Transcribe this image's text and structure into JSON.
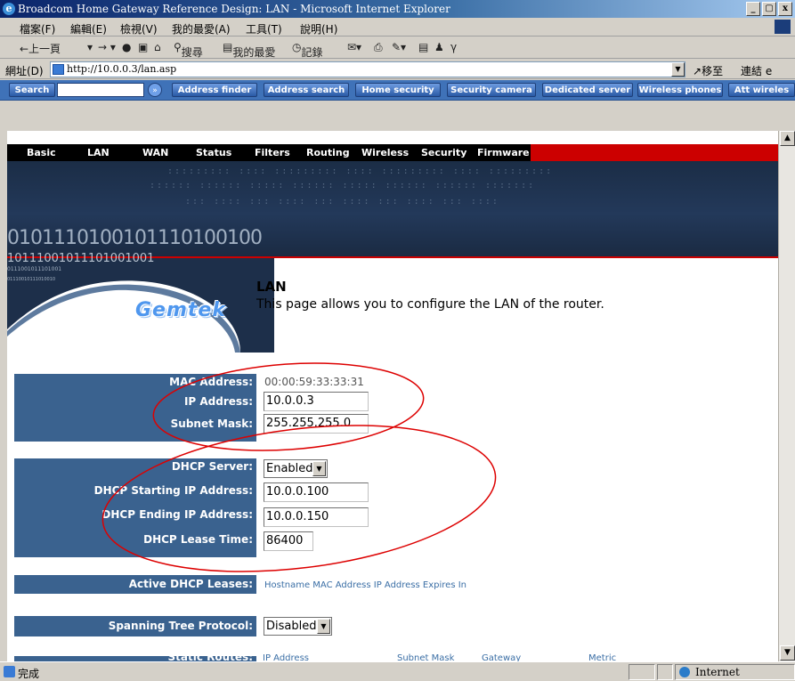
{
  "window": {
    "title": "Broadcom Home Gateway Reference Design: LAN - Microsoft Internet Explorer",
    "buttons": [
      "_",
      "❐",
      "X"
    ]
  },
  "menu": [
    "檔案(F)",
    "編輯(E)",
    "檢視(V)",
    "我的最愛(A)",
    "工具(T)",
    "說明(H)"
  ],
  "toolbar": {
    "back": "←上一頁",
    "search": "搜尋",
    "favorites": "我的最愛",
    "history": "記錄"
  },
  "address": {
    "label": "網址(D)",
    "url": "http://10.0.0.3/lan.asp",
    "go": "移至",
    "links": "連結"
  },
  "searchbar": {
    "label": "Search",
    "buttons": [
      "Address finder",
      "Address search",
      "Home security",
      "Security camera",
      "Dedicated server",
      "Wireless phones",
      "Att wireles"
    ]
  },
  "nav": [
    "Basic",
    "LAN",
    "WAN",
    "Status",
    "Filters",
    "Routing",
    "Wireless",
    "Security",
    "Firmware"
  ],
  "banner": {
    "binary_large": "0101110100101110100100",
    "binary_mid": "10111001011101001001",
    "binary_small": "0111001011101001",
    "binary_tiny": "01110010111010010"
  },
  "logo": {
    "text": "Gemtek"
  },
  "page": {
    "title": "LAN",
    "description": "This page allows you to configure the LAN of the router."
  },
  "lan": {
    "mac_label": "MAC Address:",
    "mac_value": "00:00:59:33:33:31",
    "ip_label": "IP Address:",
    "ip_value": "10.0.0.3",
    "mask_label": "Subnet Mask:",
    "mask_value": "255.255.255.0"
  },
  "dhcp": {
    "server_label": "DHCP Server:",
    "server_value": "Enabled",
    "start_label": "DHCP Starting IP Address:",
    "start_value": "10.0.0.100",
    "end_label": "DHCP Ending IP Address:",
    "end_value": "10.0.0.150",
    "lease_label": "DHCP Lease Time:",
    "lease_value": "86400"
  },
  "leases": {
    "label": "Active DHCP Leases:",
    "columns": "Hostname MAC Address IP Address Expires In"
  },
  "stp": {
    "label": "Spanning Tree Protocol:",
    "value": "Disabled"
  },
  "static": {
    "label": "Static Routes:",
    "columns": [
      "IP Address",
      "Subnet Mask",
      "Gateway",
      "Metric"
    ]
  },
  "status": {
    "text": "完成",
    "zone": "Internet"
  },
  "colors": {
    "label_bg": "#3a628f",
    "annotation": "#dd0000",
    "nav_red": "#cc0000"
  }
}
